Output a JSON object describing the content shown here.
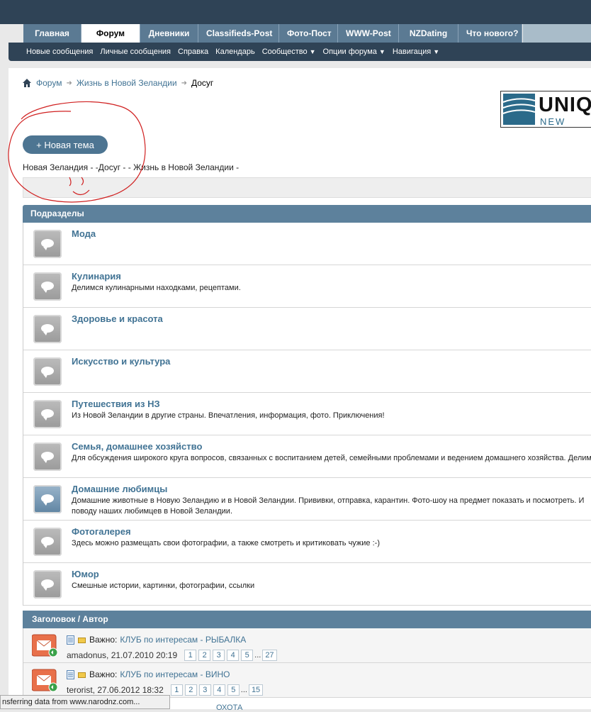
{
  "nav": {
    "tabs": [
      "Главная",
      "Форум",
      "Дневники",
      "Classifieds-Post",
      "Фото-Пост",
      "WWW-Post",
      "NZDating",
      "Что нового?"
    ],
    "active_tab": "Форум"
  },
  "subnav": {
    "new_posts": "Новые сообщения",
    "private": "Личные сообщения",
    "help": "Справка",
    "calendar": "Календарь",
    "community": "Сообщество",
    "options": "Опции форума",
    "navigation": "Навигация"
  },
  "breadcrumb": {
    "forum": "Форум",
    "life": "Жизнь в Новой Зеландии",
    "current": "Досуг"
  },
  "logo": {
    "text": "UNIQ",
    "sub": "NEW ZEA"
  },
  "new_topic_label": "+ Новая тема",
  "tagline": "Новая Зеландия - -Досуг - - Жизнь в Новой Зеландии -",
  "subforums_header": "Подразделы",
  "forums": [
    {
      "title": "Мода",
      "desc": ""
    },
    {
      "title": "Кулинария",
      "desc": "Делимся кулинарными находками, рецептами."
    },
    {
      "title": "Здоровье и красота",
      "desc": ""
    },
    {
      "title": "Искусство и культура",
      "desc": ""
    },
    {
      "title": "Путешествия из НЗ",
      "desc": "Из Новой Зеландии в другие страны. Впечатления, информация, фото. Приключения!"
    },
    {
      "title": "Семья, домашнее хозяйство",
      "desc": "Для обсуждения широкого круга вопросов, связанных с воспитанием детей, семейными проблемами и ведением домашнего хозяйства. Делимс"
    },
    {
      "title": "Домашние любимцы",
      "desc": "Домашние животные в Новую Зеландию и в Новой Зеландии. Прививки, отправка, карантин. Фото-шоу на предмет показать и посмотреть. И поводу наших любимцев в Новой Зеландии."
    },
    {
      "title": "Фотогалерея",
      "desc": "Здесь можно размещать свои фотографии, а также смотреть и критиковать чужие :-)"
    },
    {
      "title": "Юмор",
      "desc": "Смешные истории, картинки, фотографии, ссылки"
    }
  ],
  "threads_header": "Заголовок / Автор",
  "threads": [
    {
      "label": "Важно:",
      "title": "КЛУБ по интересам - РЫБАЛКА",
      "author": "amadonus, 21.07.2010 20:19",
      "pages": [
        "1",
        "2",
        "3",
        "4",
        "5"
      ],
      "last_page": "27"
    },
    {
      "label": "Важно:",
      "title": "КЛУБ по интересам - ВИНО",
      "author": "terorist, 27.06.2012 18:32",
      "pages": [
        "1",
        "2",
        "3",
        "4",
        "5"
      ],
      "last_page": "15"
    }
  ],
  "status_text": "nsferring data from www.narodnz.com...",
  "partial_text": "ОХОТА"
}
